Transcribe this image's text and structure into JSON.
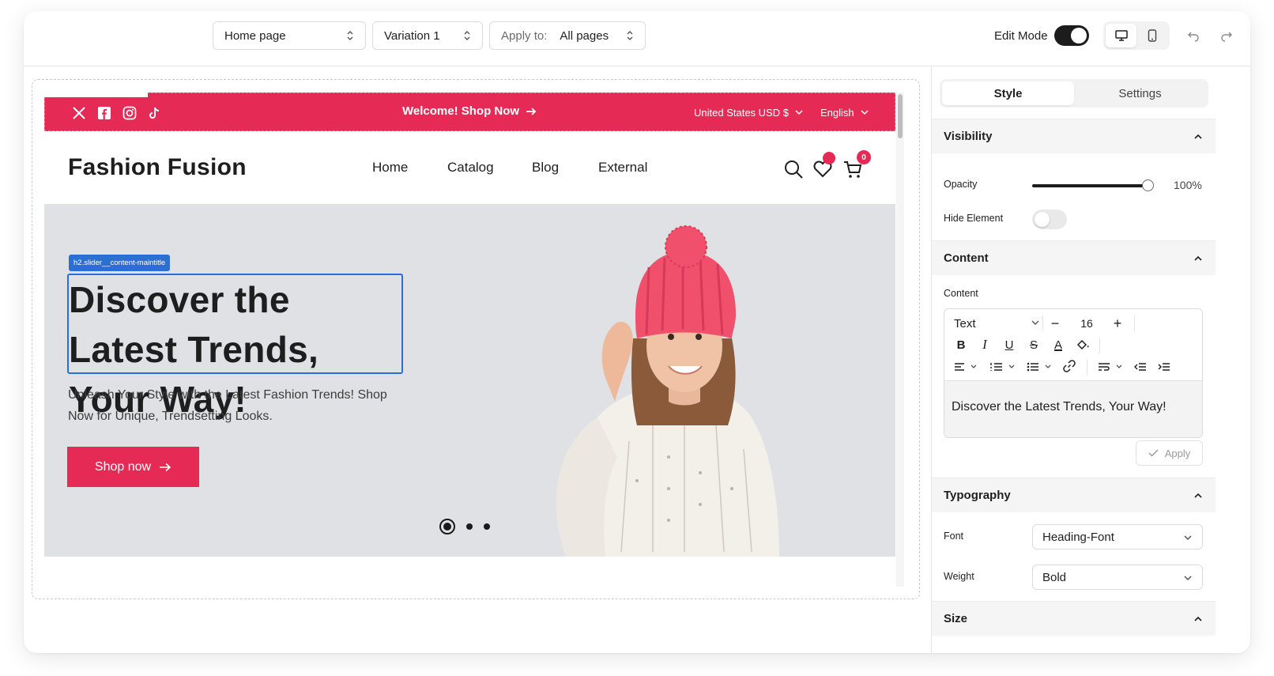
{
  "toolbar": {
    "page_select": "Home page",
    "variation_select": "Variation 1",
    "apply_to_label": "Apply to:",
    "apply_to_value": "All pages",
    "edit_mode_label": "Edit Mode",
    "edit_mode_on": true,
    "active_device": "desktop"
  },
  "site": {
    "announcement": {
      "social_icons": [
        "x-icon",
        "facebook-icon",
        "instagram-icon",
        "tiktok-icon"
      ],
      "welcome_text": "Welcome! Shop Now",
      "currency": "United States USD $",
      "language": "English",
      "bg_color": "#e52b55"
    },
    "header": {
      "brand": "Fashion Fusion",
      "nav": [
        "Home",
        "Catalog",
        "Blog",
        "External"
      ],
      "cart_count": "0"
    },
    "hero": {
      "selected_element_tag": "h2.slider__content-maintitle",
      "title": "Discover the Latest Trends, Your Way!",
      "subtitle": "Unleash Your Style with the Latest Fashion Trends! Shop Now for Unique, Trendsetting Looks.",
      "button_label": "Shop now",
      "slides_total": 3,
      "active_slide": 1
    }
  },
  "panel": {
    "tabs": [
      "Style",
      "Settings"
    ],
    "active_tab": "Style",
    "visibility": {
      "title": "Visibility",
      "opacity_label": "Opacity",
      "opacity_value": "100%",
      "hide_label": "Hide Element",
      "hidden": false
    },
    "content": {
      "title": "Content",
      "field_label": "Content",
      "text_type": "Text",
      "font_size": "16",
      "value": "Discover the Latest Trends, Your Way!",
      "apply_label": "Apply"
    },
    "typography": {
      "title": "Typography",
      "font_label": "Font",
      "font_value": "Heading-Font",
      "weight_label": "Weight",
      "weight_value": "Bold"
    },
    "size": {
      "title": "Size"
    }
  }
}
